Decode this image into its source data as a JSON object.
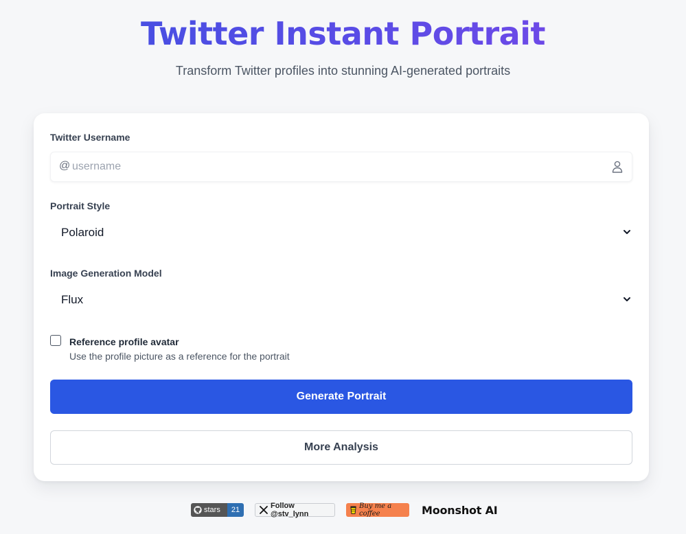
{
  "header": {
    "title": "Twitter Instant Portrait",
    "subtitle": "Transform Twitter profiles into stunning AI-generated portraits"
  },
  "form": {
    "username": {
      "label": "Twitter Username",
      "prefix": "@",
      "value": "",
      "placeholder": "username",
      "icon": "user-icon"
    },
    "portrait_style": {
      "label": "Portrait Style",
      "selected": "Polaroid"
    },
    "model": {
      "label": "Image Generation Model",
      "selected": "Flux"
    },
    "reference_avatar": {
      "checked": false,
      "label": "Reference profile avatar",
      "description": "Use the profile picture as a reference for the portrait"
    },
    "generate_label": "Generate Portrait",
    "more_label": "More Analysis"
  },
  "footer": {
    "github_badge": {
      "label": "stars",
      "count": "21"
    },
    "x_follow_badge": {
      "label": "Follow @stv_lynn"
    },
    "coffee_badge": {
      "label": "Buy me a coffee"
    },
    "moonshot": {
      "label": "Moonshot AI"
    }
  },
  "colors": {
    "title_gradient_start": "#3e4fe0",
    "title_gradient_end": "#7b47e8",
    "primary_button": "#2a57e3",
    "background": "#f6f7f9",
    "github_count_bg": "#2f6fb2",
    "coffee_bg": "#f5814d"
  }
}
